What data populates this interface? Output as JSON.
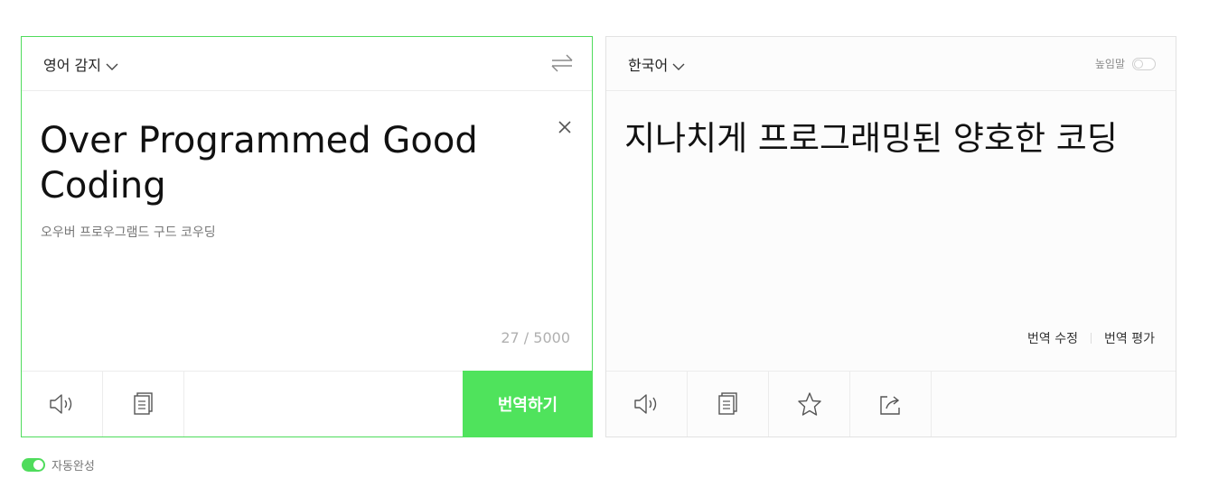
{
  "source": {
    "language": "영어 감지",
    "text": "Over Programmed Good Coding",
    "pronunciation": "오우버 프로우그램드 구드 코우딩",
    "char_count": "27 / 5000",
    "translate_label": "번역하기"
  },
  "target": {
    "language": "한국어",
    "honorific_label": "높임말",
    "text": "지나치게 프로그래밍된 양호한 코딩",
    "edit_label": "번역 수정",
    "rate_label": "번역 평가"
  },
  "footer": {
    "autocomplete_label": "자동완성"
  },
  "colors": {
    "accent": "#4fe35c",
    "border_active": "#4fdc5c"
  }
}
